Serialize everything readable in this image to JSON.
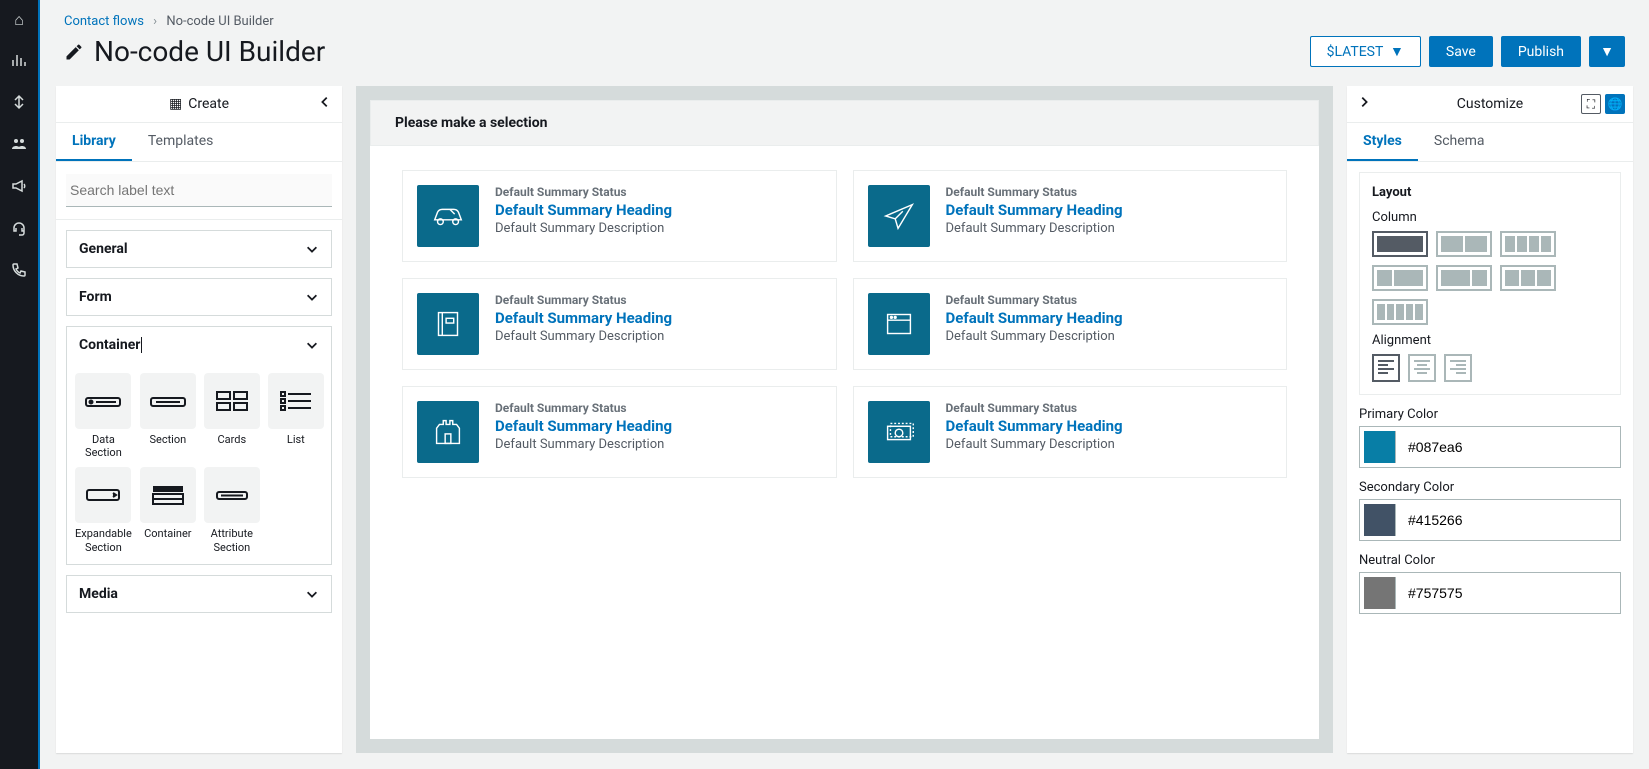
{
  "breadcrumb": {
    "link": "Contact flows",
    "current": "No-code UI Builder"
  },
  "title": "No-code UI Builder",
  "actions": {
    "version": "$LATEST",
    "save": "Save",
    "publish": "Publish"
  },
  "leftPanel": {
    "headerLabel": "Create",
    "tabs": [
      "Library",
      "Templates"
    ],
    "activeTab": 0,
    "searchPlaceholder": "Search label text",
    "sections": {
      "general": "General",
      "form": "Form",
      "container": "Container",
      "media": "Media"
    },
    "containerItems": [
      "Data Section",
      "Section",
      "Cards",
      "List",
      "Expandable Section",
      "Container",
      "Attribute Section"
    ]
  },
  "canvas": {
    "banner": "Please make a selection",
    "cardStatus": "Default Summary Status",
    "cardHeading": "Default Summary Heading",
    "cardDesc": "Default Summary Description"
  },
  "rightPanel": {
    "headerLabel": "Customize",
    "tabs": [
      "Styles",
      "Schema"
    ],
    "activeTab": 0,
    "layoutLabel": "Layout",
    "columnLabel": "Column",
    "alignmentLabel": "Alignment",
    "primaryColorLabel": "Primary Color",
    "primaryColor": "#087ea6",
    "secondaryColorLabel": "Secondary Color",
    "secondaryColor": "#415266",
    "neutralColorLabel": "Neutral Color",
    "neutralColor": "#757575"
  }
}
